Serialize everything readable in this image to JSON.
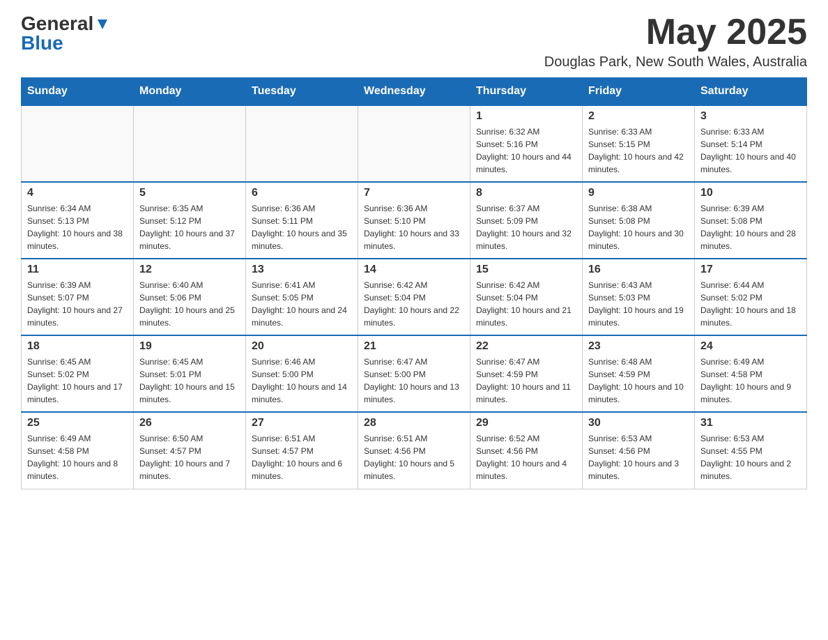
{
  "header": {
    "logo_general": "General",
    "logo_blue": "Blue",
    "month_title": "May 2025",
    "location": "Douglas Park, New South Wales, Australia"
  },
  "days_of_week": [
    "Sunday",
    "Monday",
    "Tuesday",
    "Wednesday",
    "Thursday",
    "Friday",
    "Saturday"
  ],
  "weeks": [
    [
      {
        "day": "",
        "info": ""
      },
      {
        "day": "",
        "info": ""
      },
      {
        "day": "",
        "info": ""
      },
      {
        "day": "",
        "info": ""
      },
      {
        "day": "1",
        "info": "Sunrise: 6:32 AM\nSunset: 5:16 PM\nDaylight: 10 hours and 44 minutes."
      },
      {
        "day": "2",
        "info": "Sunrise: 6:33 AM\nSunset: 5:15 PM\nDaylight: 10 hours and 42 minutes."
      },
      {
        "day": "3",
        "info": "Sunrise: 6:33 AM\nSunset: 5:14 PM\nDaylight: 10 hours and 40 minutes."
      }
    ],
    [
      {
        "day": "4",
        "info": "Sunrise: 6:34 AM\nSunset: 5:13 PM\nDaylight: 10 hours and 38 minutes."
      },
      {
        "day": "5",
        "info": "Sunrise: 6:35 AM\nSunset: 5:12 PM\nDaylight: 10 hours and 37 minutes."
      },
      {
        "day": "6",
        "info": "Sunrise: 6:36 AM\nSunset: 5:11 PM\nDaylight: 10 hours and 35 minutes."
      },
      {
        "day": "7",
        "info": "Sunrise: 6:36 AM\nSunset: 5:10 PM\nDaylight: 10 hours and 33 minutes."
      },
      {
        "day": "8",
        "info": "Sunrise: 6:37 AM\nSunset: 5:09 PM\nDaylight: 10 hours and 32 minutes."
      },
      {
        "day": "9",
        "info": "Sunrise: 6:38 AM\nSunset: 5:08 PM\nDaylight: 10 hours and 30 minutes."
      },
      {
        "day": "10",
        "info": "Sunrise: 6:39 AM\nSunset: 5:08 PM\nDaylight: 10 hours and 28 minutes."
      }
    ],
    [
      {
        "day": "11",
        "info": "Sunrise: 6:39 AM\nSunset: 5:07 PM\nDaylight: 10 hours and 27 minutes."
      },
      {
        "day": "12",
        "info": "Sunrise: 6:40 AM\nSunset: 5:06 PM\nDaylight: 10 hours and 25 minutes."
      },
      {
        "day": "13",
        "info": "Sunrise: 6:41 AM\nSunset: 5:05 PM\nDaylight: 10 hours and 24 minutes."
      },
      {
        "day": "14",
        "info": "Sunrise: 6:42 AM\nSunset: 5:04 PM\nDaylight: 10 hours and 22 minutes."
      },
      {
        "day": "15",
        "info": "Sunrise: 6:42 AM\nSunset: 5:04 PM\nDaylight: 10 hours and 21 minutes."
      },
      {
        "day": "16",
        "info": "Sunrise: 6:43 AM\nSunset: 5:03 PM\nDaylight: 10 hours and 19 minutes."
      },
      {
        "day": "17",
        "info": "Sunrise: 6:44 AM\nSunset: 5:02 PM\nDaylight: 10 hours and 18 minutes."
      }
    ],
    [
      {
        "day": "18",
        "info": "Sunrise: 6:45 AM\nSunset: 5:02 PM\nDaylight: 10 hours and 17 minutes."
      },
      {
        "day": "19",
        "info": "Sunrise: 6:45 AM\nSunset: 5:01 PM\nDaylight: 10 hours and 15 minutes."
      },
      {
        "day": "20",
        "info": "Sunrise: 6:46 AM\nSunset: 5:00 PM\nDaylight: 10 hours and 14 minutes."
      },
      {
        "day": "21",
        "info": "Sunrise: 6:47 AM\nSunset: 5:00 PM\nDaylight: 10 hours and 13 minutes."
      },
      {
        "day": "22",
        "info": "Sunrise: 6:47 AM\nSunset: 4:59 PM\nDaylight: 10 hours and 11 minutes."
      },
      {
        "day": "23",
        "info": "Sunrise: 6:48 AM\nSunset: 4:59 PM\nDaylight: 10 hours and 10 minutes."
      },
      {
        "day": "24",
        "info": "Sunrise: 6:49 AM\nSunset: 4:58 PM\nDaylight: 10 hours and 9 minutes."
      }
    ],
    [
      {
        "day": "25",
        "info": "Sunrise: 6:49 AM\nSunset: 4:58 PM\nDaylight: 10 hours and 8 minutes."
      },
      {
        "day": "26",
        "info": "Sunrise: 6:50 AM\nSunset: 4:57 PM\nDaylight: 10 hours and 7 minutes."
      },
      {
        "day": "27",
        "info": "Sunrise: 6:51 AM\nSunset: 4:57 PM\nDaylight: 10 hours and 6 minutes."
      },
      {
        "day": "28",
        "info": "Sunrise: 6:51 AM\nSunset: 4:56 PM\nDaylight: 10 hours and 5 minutes."
      },
      {
        "day": "29",
        "info": "Sunrise: 6:52 AM\nSunset: 4:56 PM\nDaylight: 10 hours and 4 minutes."
      },
      {
        "day": "30",
        "info": "Sunrise: 6:53 AM\nSunset: 4:56 PM\nDaylight: 10 hours and 3 minutes."
      },
      {
        "day": "31",
        "info": "Sunrise: 6:53 AM\nSunset: 4:55 PM\nDaylight: 10 hours and 2 minutes."
      }
    ]
  ]
}
